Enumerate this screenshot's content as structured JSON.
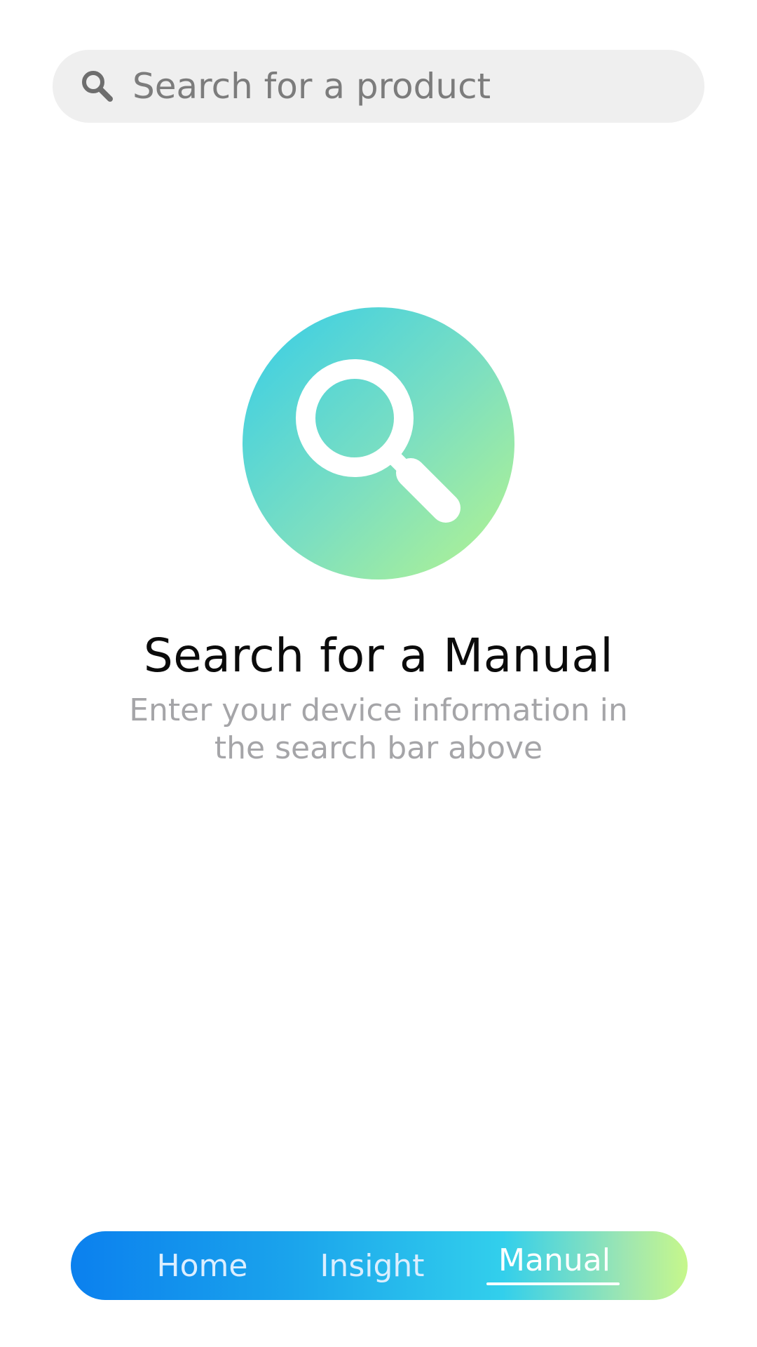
{
  "search": {
    "placeholder": "Search for a product",
    "value": ""
  },
  "empty_state": {
    "icon": "magnifier-icon",
    "title": "Search for a Manual",
    "subtitle": "Enter your device information in the search bar above"
  },
  "bottom_nav": {
    "items": [
      {
        "label": "Home"
      },
      {
        "label": "Insight"
      },
      {
        "label": "Manual"
      }
    ],
    "active": "Manual"
  },
  "colors": {
    "search_bg": "#efefef",
    "hero_gradient": [
      "#36cde8",
      "#b6f48e"
    ],
    "nav_gradient": [
      "#0b80ee",
      "#32cfec",
      "#c6f78b"
    ]
  }
}
